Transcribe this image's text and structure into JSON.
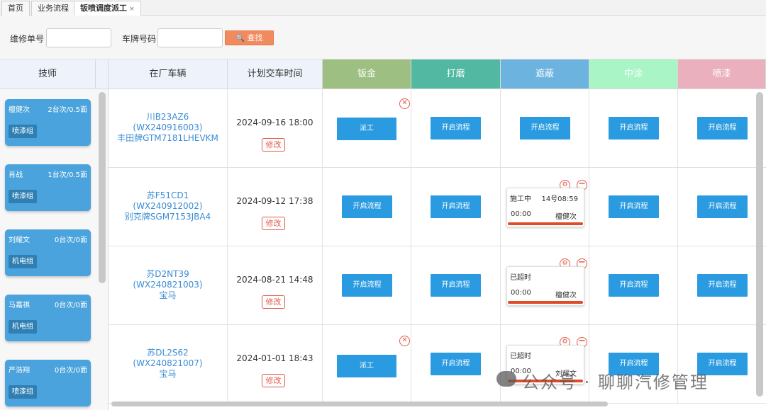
{
  "tabs": {
    "home": "首页",
    "business": "业务流程",
    "dispatch": "钣喷调度派工",
    "close": "×"
  },
  "search": {
    "order_label": "维修单号",
    "plate_label": "车牌号码",
    "search_button": "查找",
    "order_value": "",
    "plate_value": ""
  },
  "headers": {
    "tech": "技师",
    "vehicle": "在厂车辆",
    "delivery": "计划交车时间",
    "stages": [
      "钣金",
      "打磨",
      "遮蔽",
      "中涂",
      "喷漆"
    ]
  },
  "colors": {
    "sheet_metal": "#9dc082",
    "sanding": "#52b8a2",
    "masking": "#6db3df",
    "primer": "#a9f5c6",
    "paint": "#eab0bd",
    "tech_card": "#4aa3dc",
    "flow_button": "#2a9be0",
    "accent_red": "#e05a4a",
    "search_button": "#f08b5f"
  },
  "technicians": [
    {
      "name": "檀健次",
      "load": "2台次/0.5面",
      "group": "喷漆组"
    },
    {
      "name": "肖战",
      "load": "1台次/0.5面",
      "group": "喷漆组"
    },
    {
      "name": "刘耀文",
      "load": "0台次/0面",
      "group": "机电组"
    },
    {
      "name": "马嘉祺",
      "load": "0台次/0面",
      "group": "机电组"
    },
    {
      "name": "严浩翔",
      "load": "0台次/0面",
      "group": "喷漆组"
    }
  ],
  "labels": {
    "open_flow": "开启流程",
    "dispatch": "派工",
    "edit": "修改"
  },
  "rows": [
    {
      "plate": "川B23AZ6",
      "order": "(WX240916003)",
      "model": "丰田牌GTM7181LHEVKM",
      "delivery": "2024-09-16 18:00"
    },
    {
      "plate": "苏F51CD1",
      "order": "(WX240912002)",
      "model": "别克牌SGM7153JBA4",
      "delivery": "2024-09-12 17:38",
      "task": {
        "status": "施工中",
        "start": "14号08:59",
        "duration": "00:00",
        "tech": "檀健次"
      }
    },
    {
      "plate": "苏D2NT39",
      "order": "(WX240821003)",
      "model": "宝马",
      "delivery": "2024-08-21 14:48",
      "task": {
        "status": "已超时",
        "start": "",
        "duration": "00:00",
        "tech": "檀健次"
      }
    },
    {
      "plate": "苏DL2S62",
      "order": "(WX240821007)",
      "model": "宝马",
      "delivery": "2024-01-01 18:43",
      "task": {
        "status": "已超时",
        "start": "",
        "duration": "00:00",
        "tech": "刘耀文"
      }
    }
  ],
  "watermark": "公众号 · 聊聊汽修管理"
}
